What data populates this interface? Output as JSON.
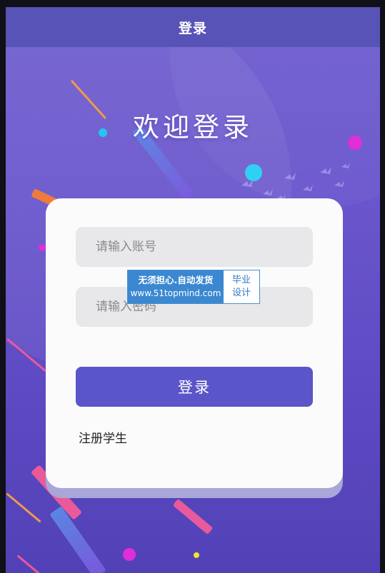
{
  "header": {
    "title": "登录"
  },
  "welcome_text": "欢迎登录",
  "form": {
    "username_placeholder": "请输入账号",
    "password_placeholder": "请输入密码",
    "login_label": "登录",
    "register_label": "注册学生"
  },
  "watermark": {
    "line1": "无须担心.自动发货",
    "line2": "www.51topmind.com",
    "right_line1": "毕业",
    "right_line2": "设计"
  },
  "colors": {
    "accent": "#5a55c8",
    "background_top": "#6f5fd0",
    "background_bottom": "#5241b6"
  }
}
